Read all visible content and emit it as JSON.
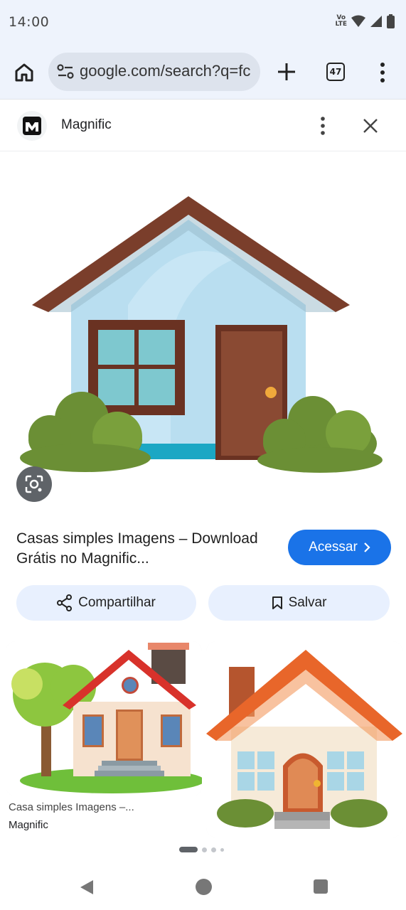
{
  "status_bar": {
    "time": "14:00",
    "volte_top": "Vo",
    "volte_bottom": "LTE"
  },
  "toolbar": {
    "url": "google.com/search?q=fc",
    "tab_count": "47"
  },
  "panel": {
    "site_name": "Magnific"
  },
  "result": {
    "title": "Casas simples Imagens – Download Grátis no Magnific...",
    "visit_label": "Acessar",
    "share_label": "Compartilhar",
    "save_label": "Salvar"
  },
  "related": [
    {
      "title": "Casa simples Imagens –...",
      "source": "Magnific"
    }
  ],
  "colors": {
    "accent": "#1a73e8",
    "pill_bg": "#e8f0fe",
    "roof": "#7a3e2b",
    "wall": "#b9def0",
    "bush": "#6b8f35"
  }
}
